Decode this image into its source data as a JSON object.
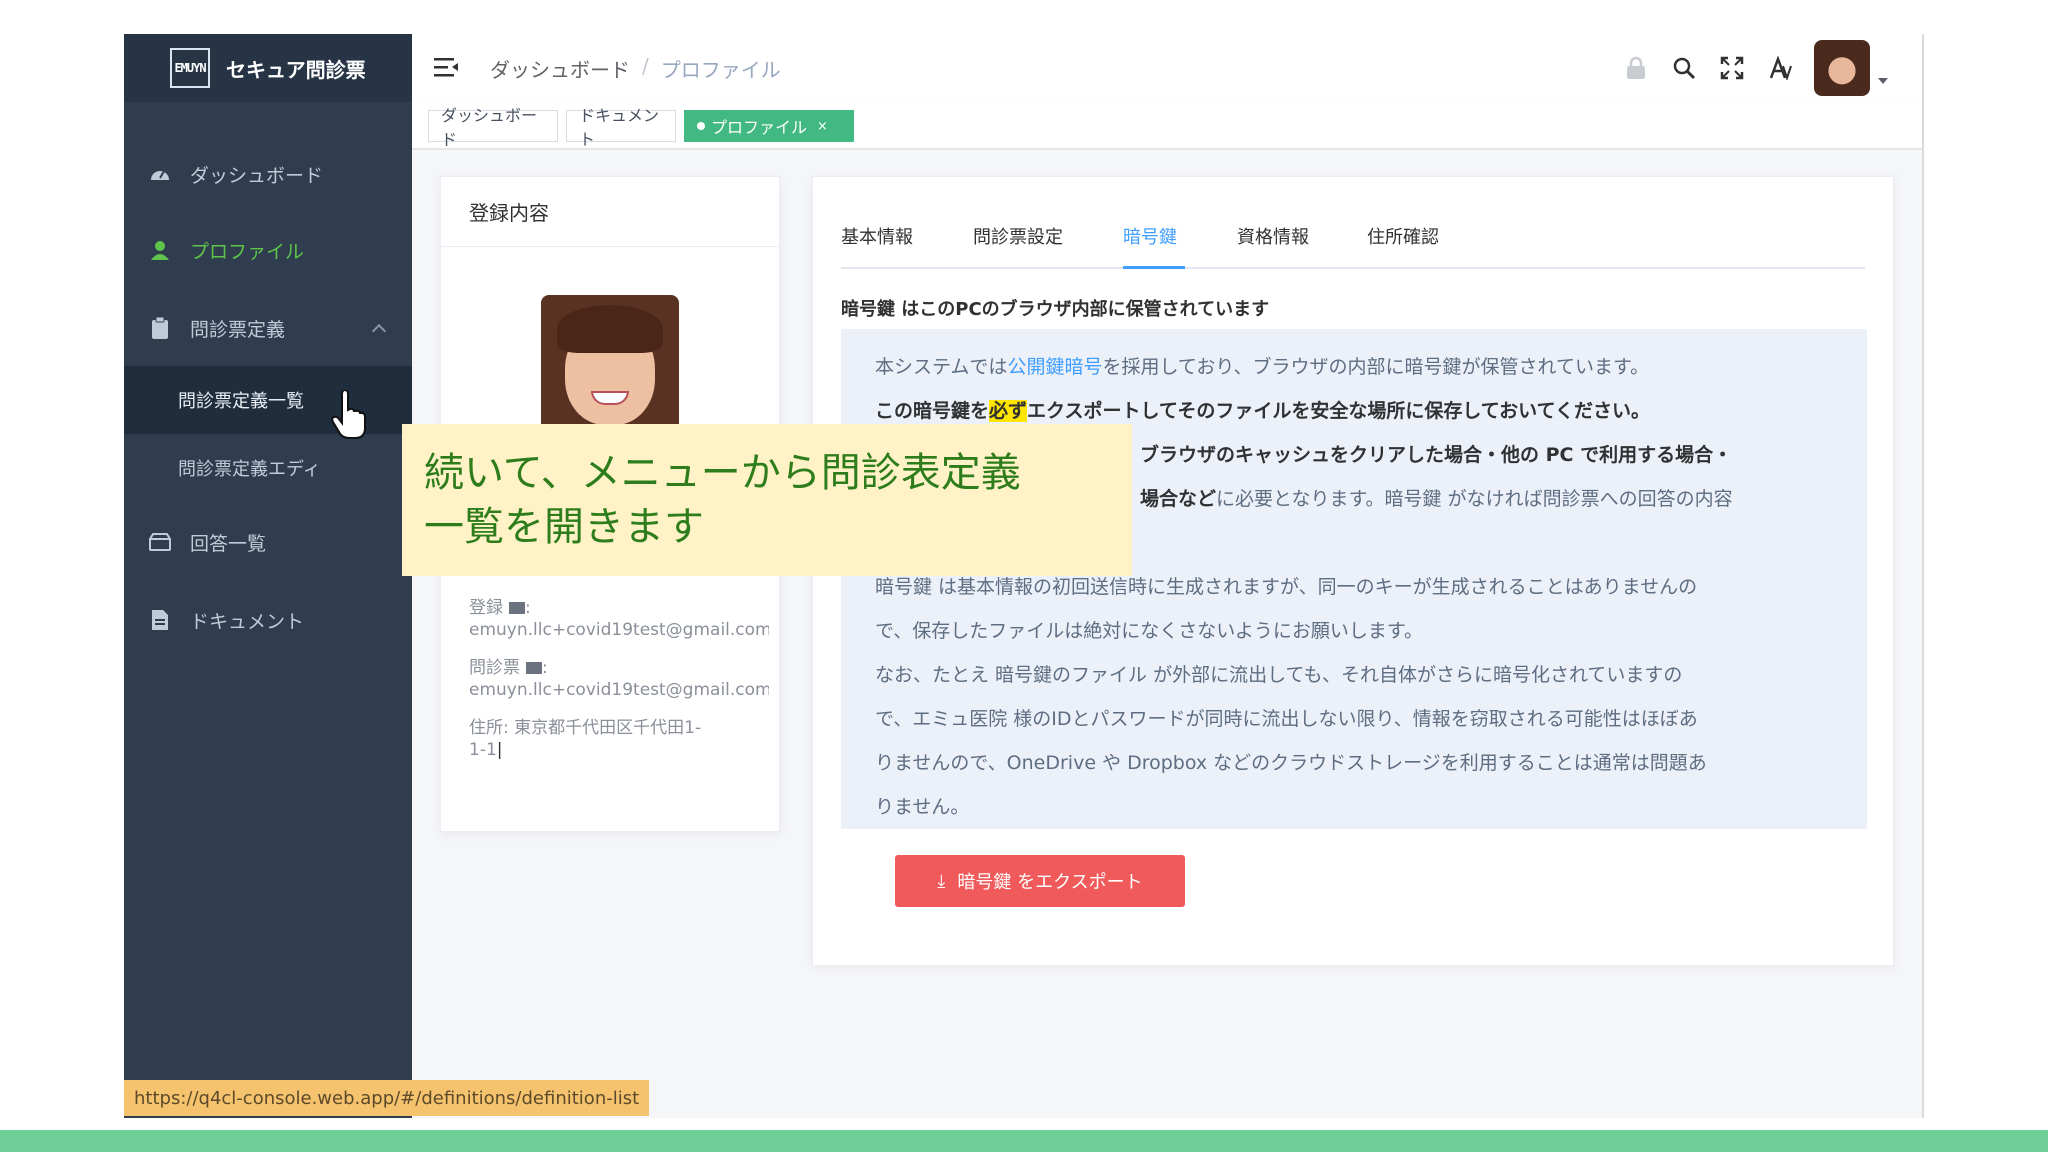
{
  "app": {
    "logo_mark": "EMUYN",
    "title": "セキュア問診票"
  },
  "sidebar": {
    "items": [
      {
        "label": "ダッシュボード",
        "icon": "dashboard-icon"
      },
      {
        "label": "プロファイル",
        "icon": "user-icon",
        "active": true
      },
      {
        "label": "問診票定義",
        "icon": "clipboard-icon",
        "expanded": true
      },
      {
        "label": "回答一覧",
        "icon": "inbox-icon"
      },
      {
        "label": "ドキュメント",
        "icon": "document-icon"
      }
    ],
    "sub_items": [
      {
        "label": "問診票定義一覧",
        "selected": true
      },
      {
        "label": "問診票定義エディ"
      }
    ]
  },
  "breadcrumb": {
    "items": [
      "ダッシュボード",
      "プロファイル"
    ],
    "separator": "/"
  },
  "top_icons": [
    "lock-icon",
    "search-icon",
    "fullscreen-icon",
    "font-size-icon",
    "avatar"
  ],
  "tags": [
    {
      "label": "ダッシュボード"
    },
    {
      "label": "ドキュメント"
    },
    {
      "label": "プロファイル",
      "active": true,
      "close": "×"
    }
  ],
  "profile_card": {
    "header": "登録内容",
    "registered_label": "登録",
    "registered_email": "emuyn.llc+covid19test@gmail.com",
    "questionnaire_label": "問診票",
    "questionnaire_email": "emuyn.llc+covid19test@gmail.com",
    "address_label": "住所:",
    "address_line1": "東京都千代田区千代田1-",
    "address_line2": "1-1"
  },
  "detail_tabs": [
    {
      "label": "基本情報"
    },
    {
      "label": "問診票設定"
    },
    {
      "label": "暗号鍵",
      "active": true
    },
    {
      "label": "資格情報"
    },
    {
      "label": "住所確認"
    }
  ],
  "key_note": "暗号鍵 はこのPCのブラウザ内部に保管されています",
  "info": {
    "line1_pre": "本システムでは",
    "line1_link": "公開鍵暗号",
    "line1_post": "を採用しており、ブラウザの内部に暗号鍵が保管されています。",
    "line2_pre": "この暗号鍵を",
    "line2_mark": "必ず",
    "line2_post": "エクスポートしてそのファイルを安全な場所に保存しておいてください。",
    "line3": "ブラウザのキャッシュをクリアした場合・他の PC で利用する場合・",
    "line4_bold": "場合など",
    "line4_rest": "に必要となります。暗号鍵 がなければ問診票への回答の内容",
    "line5": "暗号鍵 は基本情報の初回送信時に生成されますが、同一のキーが生成されることはありませんの",
    "line6": "で、保存したファイルは絶対になくさないようにお願いします。",
    "line7": "なお、たとえ 暗号鍵のファイル が外部に流出しても、それ自体がさらに暗号化されていますの",
    "line8": "で、エミュ医院 様のIDとパスワードが同時に流出しない限り、情報を窃取される可能性はほぼあ",
    "line9": "りませんので、OneDrive や Dropbox などのクラウドストレージを利用することは通常は問題あ",
    "line10": "りません。"
  },
  "export_button": {
    "icon": "⤓",
    "label": "暗号鍵 をエクスポート"
  },
  "status_url": "https://q4cl-console.web.app/#/definitions/definition-list",
  "caption": {
    "line1": "続いて、メニューから問診表定義",
    "line2": "一覧を開きます"
  },
  "colors": {
    "sidebar_bg": "#2f3d4e",
    "sidebar_active": "#5ec44a",
    "tag_active": "#42b983",
    "tab_active": "#409eff",
    "export_button": "#f15a5a",
    "caption_bg": "#fff2c6",
    "caption_text": "#2e7d1c",
    "bottom_strip": "#6dcf96"
  }
}
